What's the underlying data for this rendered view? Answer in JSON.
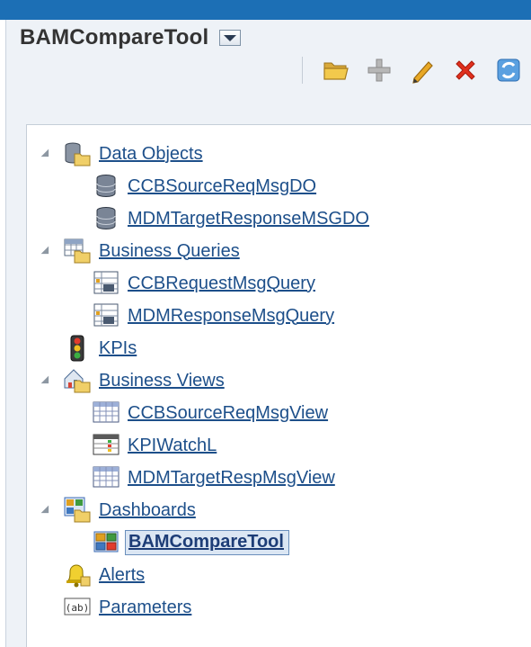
{
  "header": {
    "title": "BAMCompareTool"
  },
  "toolbar": {
    "icons": [
      "open-folder-icon",
      "add-icon",
      "edit-icon",
      "delete-icon",
      "refresh-icon"
    ]
  },
  "colors": {
    "accent": "#1c6fb5",
    "link": "#1d4f8a",
    "panel_bg": "#eef2f7",
    "selected_bg": "#dbe6f3"
  },
  "tree": {
    "data_objects": {
      "label": "Data Objects",
      "children": [
        "CCBSourceReqMsgDO",
        "MDMTargetResponseMSGDO"
      ]
    },
    "business_queries": {
      "label": "Business Queries",
      "children": [
        "CCBRequestMsgQuery",
        "MDMResponseMsgQuery"
      ]
    },
    "kpis": {
      "label": "KPIs"
    },
    "business_views": {
      "label": "Business Views",
      "children": [
        "CCBSourceReqMsgView",
        "KPIWatchL",
        "MDMTargetRespMsgView"
      ]
    },
    "dashboards": {
      "label": "Dashboards",
      "children": [
        "BAMCompareTool"
      ],
      "selected": "BAMCompareTool"
    },
    "alerts": {
      "label": "Alerts"
    },
    "parameters": {
      "label": "Parameters"
    }
  }
}
